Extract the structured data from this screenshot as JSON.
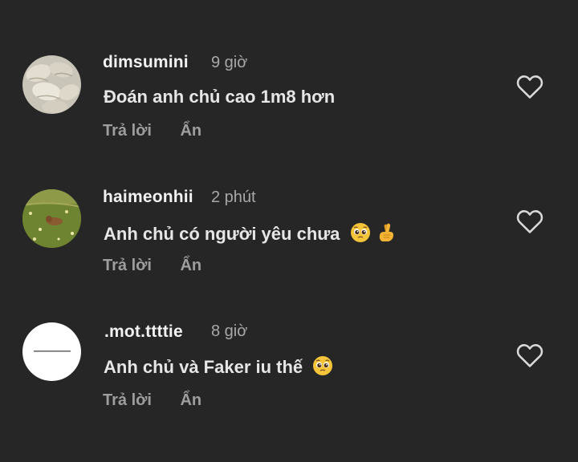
{
  "comments": [
    {
      "username": "dimsumini",
      "time": "9 giờ",
      "text": "Đoán anh chủ cao 1m8 hơn",
      "reply_label": "Trả lời",
      "hide_label": "Ẩn",
      "avatar": "dumplings-photo-avatar"
    },
    {
      "username": "haimeonhii",
      "time": "2 phút",
      "text": "Anh chủ có người yêu chưa",
      "emojis": [
        "pleading-face",
        "crossed-fingers-heart"
      ],
      "reply_label": "Trả lời",
      "hide_label": "Ẩn",
      "avatar": "field-cat-photo-avatar"
    },
    {
      "username": ".mot.ttttie",
      "time": "8 giờ",
      "text": "Anh chủ và Faker iu thế",
      "emojis": [
        "pleading-face"
      ],
      "reply_label": "Trả lời",
      "hide_label": "Ẩn",
      "avatar": "white-avatar"
    }
  ],
  "colors": {
    "background": "#262626",
    "username": "#f2f2f2",
    "text": "#e6e6e6",
    "muted": "#a8a8a8",
    "heart_outline": "#d9d9d9"
  }
}
